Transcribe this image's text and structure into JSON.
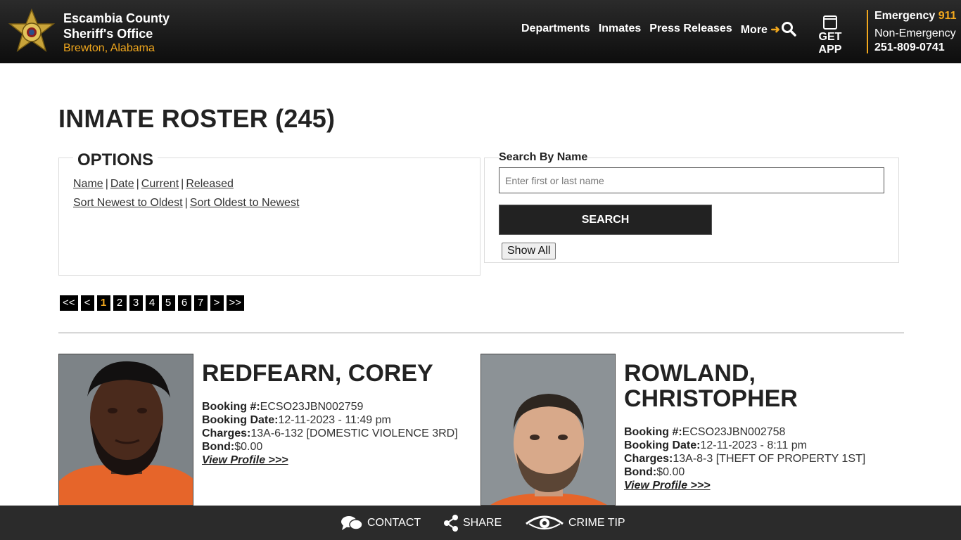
{
  "header": {
    "org_line1": "Escambia County",
    "org_line2": "Sheriff's Office",
    "location": "Brewton, Alabama",
    "nav": [
      "Departments",
      "Inmates",
      "Press Releases",
      "More"
    ],
    "get_app": "GET APP",
    "emergency_label": "Emergency",
    "emergency_number": "911",
    "non_emergency_label": "Non-Emergency",
    "non_emergency_number": "251-809-0741",
    "accent_color": "#f2a81d"
  },
  "page": {
    "title": "INMATE ROSTER (245)"
  },
  "options": {
    "title": "OPTIONS",
    "sort_by": [
      "Name",
      "Date",
      "Current",
      "Released"
    ],
    "order_newest": "Sort Newest to Oldest",
    "order_oldest": "Sort Oldest to Newest"
  },
  "search": {
    "label": "Search By Name",
    "placeholder": "Enter first or last name",
    "button": "SEARCH",
    "show_all": "Show All"
  },
  "pagination": {
    "first": "<<",
    "prev": "<",
    "pages": [
      "1",
      "2",
      "3",
      "4",
      "5",
      "6",
      "7"
    ],
    "current": "1",
    "next": ">",
    "last": ">>"
  },
  "inmates": [
    {
      "name": "REDFEARN, COREY",
      "booking_label": "Booking #:",
      "booking_number": "ECSO23JBN002759",
      "date_label": "Booking Date:",
      "booking_date": "12-11-2023 - 11:49 pm",
      "charges_label": "Charges:",
      "charges": "13A-6-132 [DOMESTIC VIOLENCE 3RD]",
      "bond_label": "Bond:",
      "bond": "$0.00",
      "link": "View Profile >>>"
    },
    {
      "name_line1": "ROWLAND,",
      "name_line2": "CHRISTOPHER",
      "booking_label": "Booking #:",
      "booking_number": "ECSO23JBN002758",
      "date_label": "Booking Date:",
      "booking_date": "12-11-2023 - 8:11 pm",
      "charges_label": "Charges:",
      "charges": "13A-8-3 [THEFT OF PROPERTY 1ST]",
      "bond_label": "Bond:",
      "bond": "$0.00",
      "link": "View Profile >>>"
    }
  ],
  "footer": {
    "contact": "CONTACT",
    "share": "SHARE",
    "crime_tip": "CRIME TIP"
  }
}
